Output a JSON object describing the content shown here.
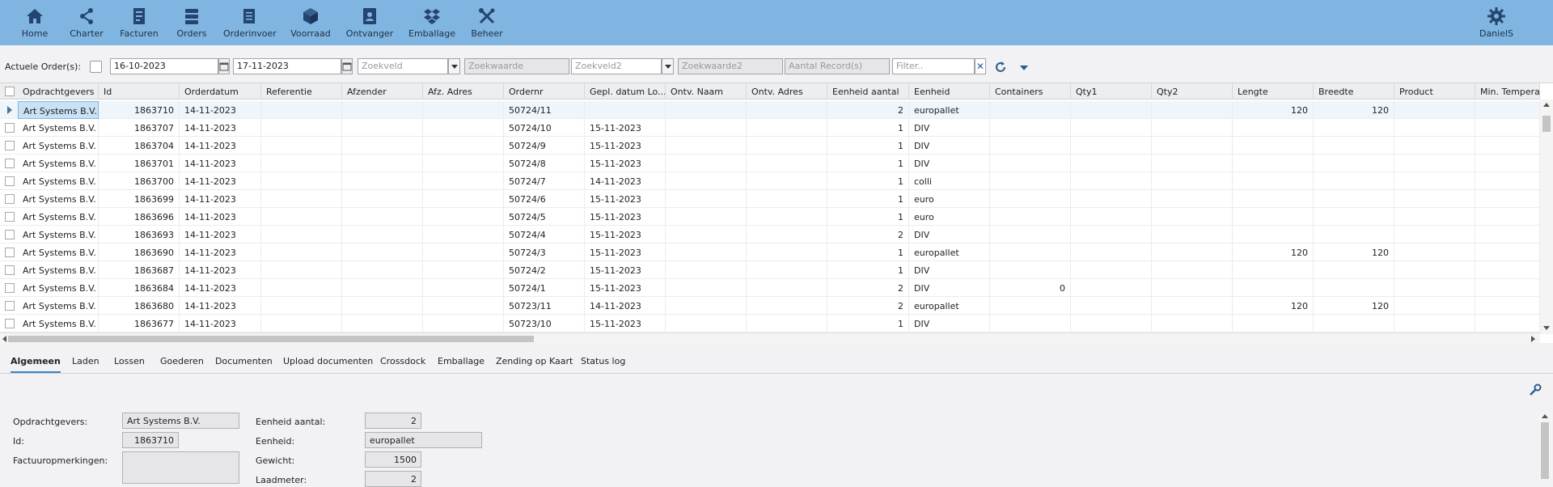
{
  "nav": {
    "items": [
      {
        "label": "Home",
        "icon": "home-icon"
      },
      {
        "label": "Charter",
        "icon": "share-icon"
      },
      {
        "label": "Facturen",
        "icon": "invoice-icon"
      },
      {
        "label": "Orders",
        "icon": "orders-icon"
      },
      {
        "label": "Orderinvoer",
        "icon": "order-entry-icon"
      },
      {
        "label": "Voorraad",
        "icon": "box-icon"
      },
      {
        "label": "Ontvanger",
        "icon": "contact-book-icon"
      },
      {
        "label": "Emballage",
        "icon": "dropbox-icon"
      },
      {
        "label": "Beheer",
        "icon": "tools-icon"
      }
    ],
    "user": {
      "label": "DanielS",
      "icon": "gear-icon"
    }
  },
  "filter": {
    "label": "Actuele Order(s):",
    "date_from": "16-10-2023",
    "date_to": "17-11-2023",
    "zoekveld_placeholder": "Zoekveld",
    "zoekwaarde_placeholder": "Zoekwaarde",
    "zoekveld2_placeholder": "Zoekveld2",
    "zoekwaarde2_placeholder": "Zoekwaarde2",
    "aantal_records_placeholder": "Aantal Record(s)",
    "filter_placeholder": "Filter.."
  },
  "grid": {
    "columns": [
      "Opdrachtgevers",
      "Id",
      "Orderdatum",
      "Referentie",
      "Afzender",
      "Afz. Adres",
      "Ordernr",
      "Gepl. datum Lo...",
      "Ontv. Naam",
      "Ontv. Adres",
      "Eenheid aantal",
      "Eenheid",
      "Containers",
      "Qty1",
      "Qty2",
      "Lengte",
      "Breedte",
      "Product",
      "Min. Temperatuur"
    ],
    "rows": [
      {
        "opdrachtgever": "Art Systems B.V.",
        "id": "1863710",
        "orderdatum": "14-11-2023",
        "ordernr": "50724/11",
        "gepl": "",
        "aantal": "2",
        "eenheid": "europallet",
        "containers": "",
        "lengte": "120",
        "breedte": "120"
      },
      {
        "opdrachtgever": "Art Systems B.V.",
        "id": "1863707",
        "orderdatum": "14-11-2023",
        "ordernr": "50724/10",
        "gepl": "15-11-2023",
        "aantal": "1",
        "eenheid": "DIV",
        "containers": "",
        "lengte": "",
        "breedte": ""
      },
      {
        "opdrachtgever": "Art Systems B.V.",
        "id": "1863704",
        "orderdatum": "14-11-2023",
        "ordernr": "50724/9",
        "gepl": "15-11-2023",
        "aantal": "1",
        "eenheid": "DIV",
        "containers": "",
        "lengte": "",
        "breedte": ""
      },
      {
        "opdrachtgever": "Art Systems B.V.",
        "id": "1863701",
        "orderdatum": "14-11-2023",
        "ordernr": "50724/8",
        "gepl": "15-11-2023",
        "aantal": "1",
        "eenheid": "DIV",
        "containers": "",
        "lengte": "",
        "breedte": ""
      },
      {
        "opdrachtgever": "Art Systems B.V.",
        "id": "1863700",
        "orderdatum": "14-11-2023",
        "ordernr": "50724/7",
        "gepl": "14-11-2023",
        "aantal": "1",
        "eenheid": "colli",
        "containers": "",
        "lengte": "",
        "breedte": ""
      },
      {
        "opdrachtgever": "Art Systems B.V.",
        "id": "1863699",
        "orderdatum": "14-11-2023",
        "ordernr": "50724/6",
        "gepl": "15-11-2023",
        "aantal": "1",
        "eenheid": "euro",
        "containers": "",
        "lengte": "",
        "breedte": ""
      },
      {
        "opdrachtgever": "Art Systems B.V.",
        "id": "1863696",
        "orderdatum": "14-11-2023",
        "ordernr": "50724/5",
        "gepl": "15-11-2023",
        "aantal": "1",
        "eenheid": "euro",
        "containers": "",
        "lengte": "",
        "breedte": ""
      },
      {
        "opdrachtgever": "Art Systems B.V.",
        "id": "1863693",
        "orderdatum": "14-11-2023",
        "ordernr": "50724/4",
        "gepl": "15-11-2023",
        "aantal": "2",
        "eenheid": "DIV",
        "containers": "",
        "lengte": "",
        "breedte": ""
      },
      {
        "opdrachtgever": "Art Systems B.V.",
        "id": "1863690",
        "orderdatum": "14-11-2023",
        "ordernr": "50724/3",
        "gepl": "15-11-2023",
        "aantal": "1",
        "eenheid": "europallet",
        "containers": "",
        "lengte": "120",
        "breedte": "120"
      },
      {
        "opdrachtgever": "Art Systems B.V.",
        "id": "1863687",
        "orderdatum": "14-11-2023",
        "ordernr": "50724/2",
        "gepl": "15-11-2023",
        "aantal": "1",
        "eenheid": "DIV",
        "containers": "",
        "lengte": "",
        "breedte": ""
      },
      {
        "opdrachtgever": "Art Systems B.V.",
        "id": "1863684",
        "orderdatum": "14-11-2023",
        "ordernr": "50724/1",
        "gepl": "15-11-2023",
        "aantal": "2",
        "eenheid": "DIV",
        "containers": "0",
        "lengte": "",
        "breedte": ""
      },
      {
        "opdrachtgever": "Art Systems B.V.",
        "id": "1863680",
        "orderdatum": "14-11-2023",
        "ordernr": "50723/11",
        "gepl": "14-11-2023",
        "aantal": "2",
        "eenheid": "europallet",
        "containers": "",
        "lengte": "120",
        "breedte": "120"
      },
      {
        "opdrachtgever": "Art Systems B.V.",
        "id": "1863677",
        "orderdatum": "14-11-2023",
        "ordernr": "50723/10",
        "gepl": "15-11-2023",
        "aantal": "1",
        "eenheid": "DIV",
        "containers": "",
        "lengte": "",
        "breedte": ""
      }
    ]
  },
  "tabs": [
    "Algemeen",
    "Laden",
    "Lossen",
    "Goederen",
    "Documenten",
    "Upload documenten",
    "Crossdock",
    "Emballage",
    "Zending op Kaart",
    "Status log"
  ],
  "detail": {
    "opdrachtgevers_label": "Opdrachtgevers:",
    "opdrachtgevers_value": "Art Systems B.V.",
    "id_label": "Id:",
    "id_value": "1863710",
    "factuur_label": "Factuuropmerkingen:",
    "factuur_value": "",
    "eenheid_aantal_label": "Eenheid aantal:",
    "eenheid_aantal_value": "2",
    "eenheid_label": "Eenheid:",
    "eenheid_value": "europallet",
    "gewicht_label": "Gewicht:",
    "gewicht_value": "1500",
    "laadmeter_label": "Laadmeter:",
    "laadmeter_value": "2"
  },
  "colors": {
    "topbar": "#7fb5e0",
    "accent": "#3b82c4"
  }
}
